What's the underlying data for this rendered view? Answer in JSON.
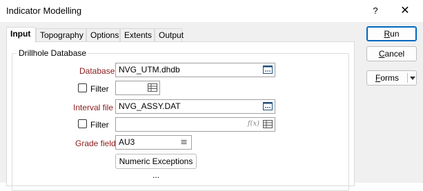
{
  "window": {
    "title": "Indicator Modelling",
    "help_label": "?",
    "close_label": "✕"
  },
  "tabs": [
    {
      "label": "Input"
    },
    {
      "label": "Topography"
    },
    {
      "label": "Options"
    },
    {
      "label": "Extents"
    },
    {
      "label": "Output"
    }
  ],
  "group": {
    "title": "Drillhole Database"
  },
  "database": {
    "label": "Database",
    "value": "NVG_UTM.dhdb"
  },
  "filter1": {
    "label": "Filter",
    "checked": false,
    "value": ""
  },
  "interval": {
    "label": "Interval file",
    "value": "NVG_ASSY.DAT"
  },
  "filter2": {
    "label": "Filter",
    "checked": false,
    "value": "",
    "fx": "f(x)"
  },
  "grade": {
    "label": "Grade field",
    "value": "AU3"
  },
  "numeric_exceptions": {
    "label": "Numeric Exceptions ..."
  },
  "side_buttons": {
    "run": {
      "mnemonic": "R",
      "rest": "un"
    },
    "cancel": {
      "mnemonic": "C",
      "rest": "ancel"
    },
    "forms": {
      "mnemonic": "F",
      "rest": "orms"
    }
  }
}
